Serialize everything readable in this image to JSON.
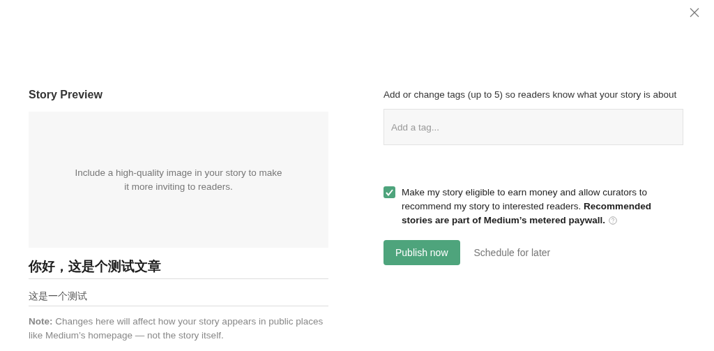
{
  "preview": {
    "heading": "Story Preview",
    "image_hint": "Include a high-quality image in your story to make it more inviting to readers.",
    "title": "你好，这是个测试文章",
    "subtitle": "这是一个测试",
    "note": "**Note:** Changes here will affect how your story appears in public places like Medium’s homepage — not the story itself."
  },
  "tags": {
    "label": "Add or change tags (up to 5) so readers know what your story is about",
    "placeholder": "Add a tag..."
  },
  "eligibility": {
    "checked": true,
    "text": "Make my story eligible to earn money and allow curators to recommend my story to interested readers. **Recommended stories are part of Medium’s metered paywall.**"
  },
  "actions": {
    "primary": "Publish now",
    "secondary": "Schedule for later"
  }
}
